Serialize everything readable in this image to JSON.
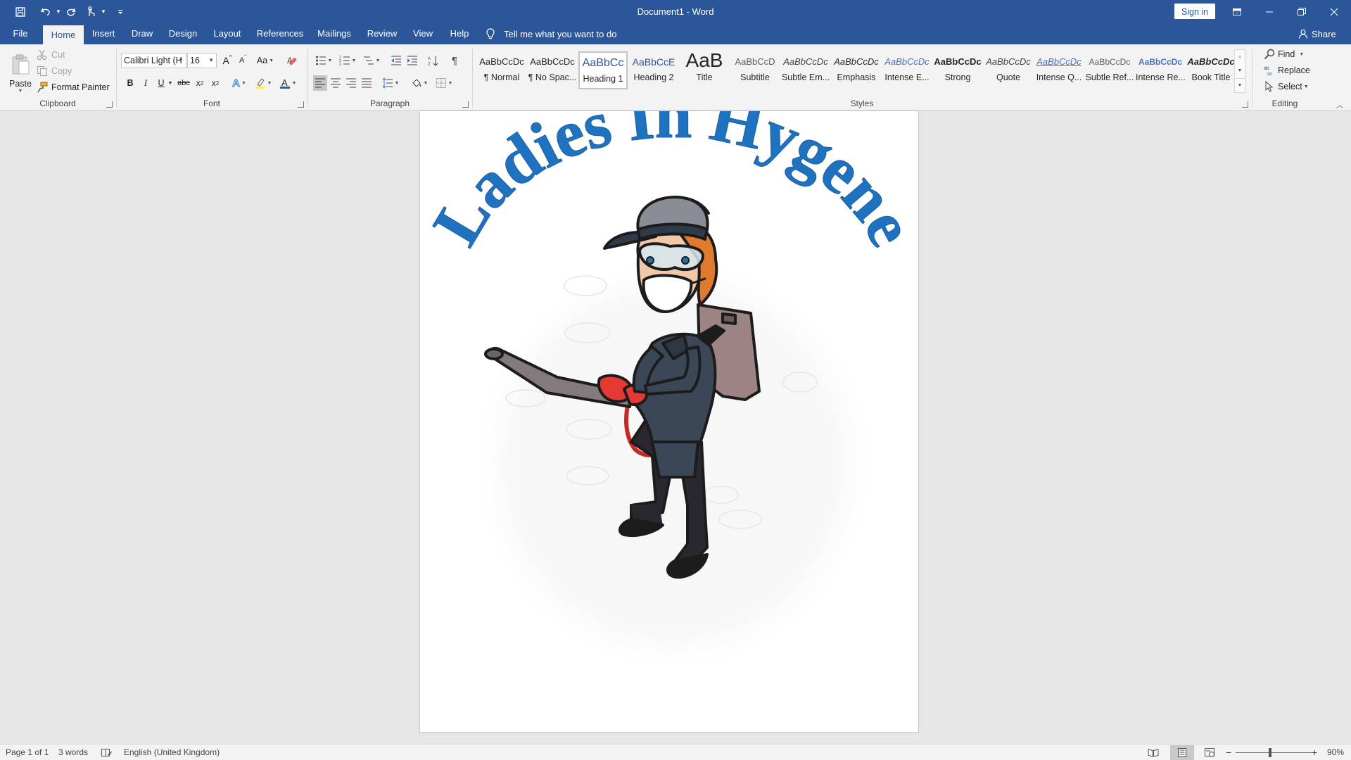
{
  "window": {
    "document_title": "Document1 - Word",
    "sign_in_label": "Sign in",
    "share_label": "Share",
    "tell_me": "Tell me what you want to do"
  },
  "tabs": [
    {
      "label": "File"
    },
    {
      "label": "Home"
    },
    {
      "label": "Insert"
    },
    {
      "label": "Draw"
    },
    {
      "label": "Design"
    },
    {
      "label": "Layout"
    },
    {
      "label": "References"
    },
    {
      "label": "Mailings"
    },
    {
      "label": "Review"
    },
    {
      "label": "View"
    },
    {
      "label": "Help"
    }
  ],
  "active_tab": "Home",
  "clipboard": {
    "paste_label": "Paste",
    "cut_label": "Cut",
    "copy_label": "Copy",
    "format_painter_label": "Format Painter",
    "group_label": "Clipboard"
  },
  "font": {
    "font_name": "Calibri Light (H",
    "font_size": "16",
    "change_case_label": "Aa",
    "group_label": "Font"
  },
  "paragraph": {
    "group_label": "Paragraph"
  },
  "styles": {
    "group_label": "Styles",
    "items": [
      {
        "sample": "AaBbCcDc",
        "name": "¶ Normal"
      },
      {
        "sample": "AaBbCcDc",
        "name": "¶ No Spac..."
      },
      {
        "sample": "AaBbCc",
        "name": "Heading 1"
      },
      {
        "sample": "AaBbCcE",
        "name": "Heading 2"
      },
      {
        "sample": "AaB",
        "name": "Title"
      },
      {
        "sample": "AaBbCcD",
        "name": "Subtitle"
      },
      {
        "sample": "AaBbCcDc",
        "name": "Subtle Em..."
      },
      {
        "sample": "AaBbCcDc",
        "name": "Emphasis"
      },
      {
        "sample": "AaBbCcDc",
        "name": "Intense E..."
      },
      {
        "sample": "AaBbCcDc",
        "name": "Strong"
      },
      {
        "sample": "AaBbCcDc",
        "name": "Quote"
      },
      {
        "sample": "AaBbCcDc",
        "name": "Intense Q..."
      },
      {
        "sample": "AaBbCcDc",
        "name": "Subtle Ref..."
      },
      {
        "sample": "AaBbCcDc",
        "name": "Intense Re..."
      },
      {
        "sample": "AaBbCcDc",
        "name": "Book Title"
      }
    ],
    "selected": "Heading 1"
  },
  "editing": {
    "find_label": "Find",
    "replace_label": "Replace",
    "select_label": "Select",
    "group_label": "Editing"
  },
  "document": {
    "wordart_text": "Ladies In Hygene"
  },
  "colors": {
    "brand_blue": "#2b579a",
    "wordart_blue": "#1f72c0"
  },
  "status": {
    "page": "Page 1 of 1",
    "words": "3 words",
    "language": "English (United Kingdom)",
    "zoom": "90%",
    "zoom_fraction": 0.45
  }
}
